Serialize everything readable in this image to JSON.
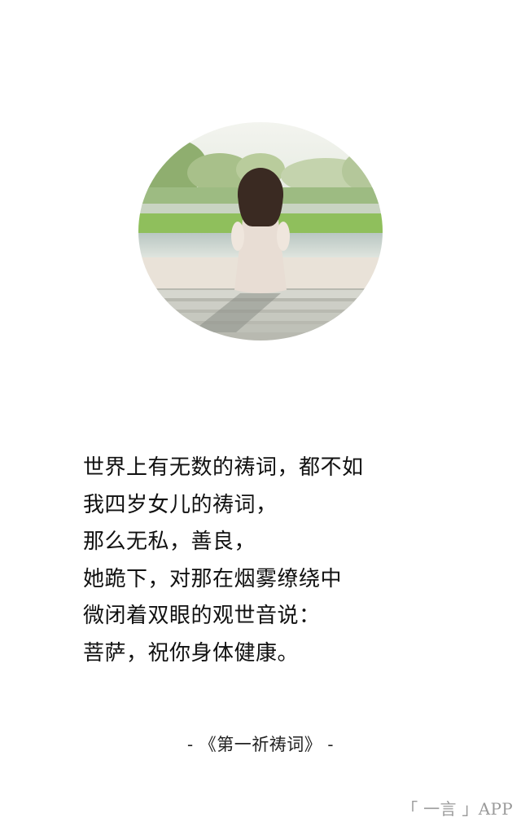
{
  "photo": {
    "alt": "",
    "icon": "photo-girl-sitting-on-dock"
  },
  "poem": {
    "lines": [
      "世界上有无数的祷词，都不如",
      "我四岁女儿的祷词，",
      "那么无私，善良，",
      "她跪下，对那在烟雾缭绕中",
      "微闭着双眼的观世音说：",
      "菩萨，祝你身体健康。"
    ]
  },
  "source": {
    "text": "- 《第一祈祷词》 -"
  },
  "app": {
    "badge": "「 一言 」APP"
  },
  "colors": {
    "background": "#ffffff",
    "text": "#111111",
    "badge": "#9a9a9a"
  }
}
